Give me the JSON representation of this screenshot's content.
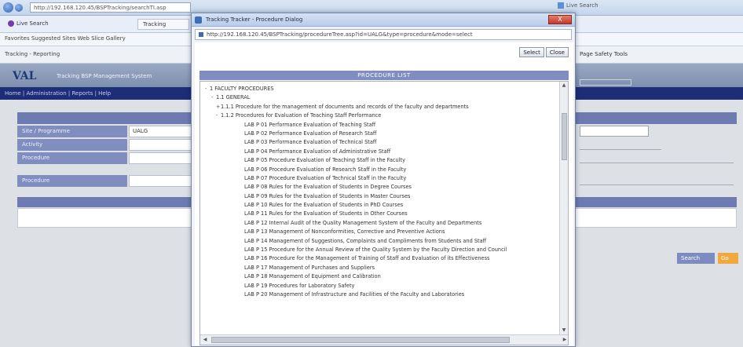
{
  "browser": {
    "url": "http://192.168.120.45/BSPTracking/searchTI.asp",
    "search_text": "Live Search",
    "tab_label": "Live Search",
    "tab_small": "Tracking",
    "favorites": "Favorites  Suggested Sites  Web Slice Gallery",
    "tab_title": "Tracking - Reporting",
    "commands": "Page  Safety  Tools"
  },
  "app": {
    "logo": "VAL",
    "subtitle": "Tracking BSP Management System",
    "nav_link": "Home  |  Administration  |  Reports  |  Help"
  },
  "form": {
    "rows": [
      {
        "label": "Site / Programme",
        "value": "UALG"
      },
      {
        "label": "Activity",
        "value": ""
      },
      {
        "label": "Procedure",
        "value": ""
      },
      {
        "label": "Procedure",
        "value": ""
      }
    ],
    "next_button": "Search",
    "clear_button": "Go"
  },
  "popup": {
    "title": "Tracking Tracker - Procedure Dialog",
    "url": "http://192.168.120.45/BSPTracking/procedureTree.asp?id=UALG&type=procedure&mode=select",
    "close_label": "X",
    "ok_button": "Select",
    "cancel_button": "Close",
    "tree_header": "PROCEDURE LIST"
  },
  "tree_items": [
    {
      "level": 0,
      "toggle": "-",
      "text": "1 FACULTY PROCEDURES"
    },
    {
      "level": 1,
      "toggle": "-",
      "text": "1.1 GENERAL"
    },
    {
      "level": 2,
      "toggle": "+",
      "text": "1.1.1 Procedure for the management of documents and records of the faculty and departments"
    },
    {
      "level": 2,
      "toggle": "-",
      "text": "1.1.2 Procedures for Evaluation of Teaching Staff Performance"
    },
    {
      "level": 3,
      "toggle": "",
      "text": "LAB P 01 Performance Evaluation of Teaching Staff"
    },
    {
      "level": 3,
      "toggle": "",
      "text": "LAB P 02 Performance Evaluation of Research Staff"
    },
    {
      "level": 3,
      "toggle": "",
      "text": "LAB P 03 Performance Evaluation of Technical Staff"
    },
    {
      "level": 3,
      "toggle": "",
      "text": "LAB P 04 Performance Evaluation of Administrative Staff"
    },
    {
      "level": 3,
      "toggle": "",
      "text": "LAB P 05 Procedure Evaluation of Teaching Staff in the Faculty"
    },
    {
      "level": 3,
      "toggle": "",
      "text": "LAB P 06 Procedure Evaluation of Research Staff in the Faculty"
    },
    {
      "level": 3,
      "toggle": "",
      "text": "LAB P 07 Procedure Evaluation of Technical Staff in the Faculty"
    },
    {
      "level": 3,
      "toggle": "",
      "text": "LAB P 08 Rules for the Evaluation of Students in Degree Courses"
    },
    {
      "level": 3,
      "toggle": "",
      "text": "LAB P 09 Rules for the Evaluation of Students in Master Courses"
    },
    {
      "level": 3,
      "toggle": "",
      "text": "LAB P 10 Rules for the Evaluation of Students in PhD Courses"
    },
    {
      "level": 3,
      "toggle": "",
      "text": "LAB P 11 Rules for the Evaluation of Students in Other Courses"
    },
    {
      "level": 3,
      "toggle": "",
      "text": "LAB P 12 Internal Audit of the Quality Management System of the Faculty and Departments"
    },
    {
      "level": 3,
      "toggle": "",
      "text": "LAB P 13 Management of Nonconformities, Corrective and Preventive Actions"
    },
    {
      "level": 3,
      "toggle": "",
      "text": "LAB P 14 Management of Suggestions, Complaints and Compliments from Students and Staff"
    },
    {
      "level": 3,
      "toggle": "",
      "text": "LAB P 15 Procedure for the Annual Review of the Quality System by the Faculty Direction and Council"
    },
    {
      "level": 3,
      "toggle": "",
      "text": "LAB P 16 Procedure for the Management of Training of Staff and Evaluation of its Effectiveness"
    },
    {
      "level": 3,
      "toggle": "",
      "text": "LAB P 17 Management of Purchases and Suppliers"
    },
    {
      "level": 3,
      "toggle": "",
      "text": "LAB P 18 Management of Equipment and Calibration"
    },
    {
      "level": 3,
      "toggle": "",
      "text": "LAB P 19 Procedures for Laboratory Safety"
    },
    {
      "level": 3,
      "toggle": "",
      "text": "LAB P 20 Management of Infrastructure and Facilities of the Faculty and Laboratories"
    }
  ]
}
